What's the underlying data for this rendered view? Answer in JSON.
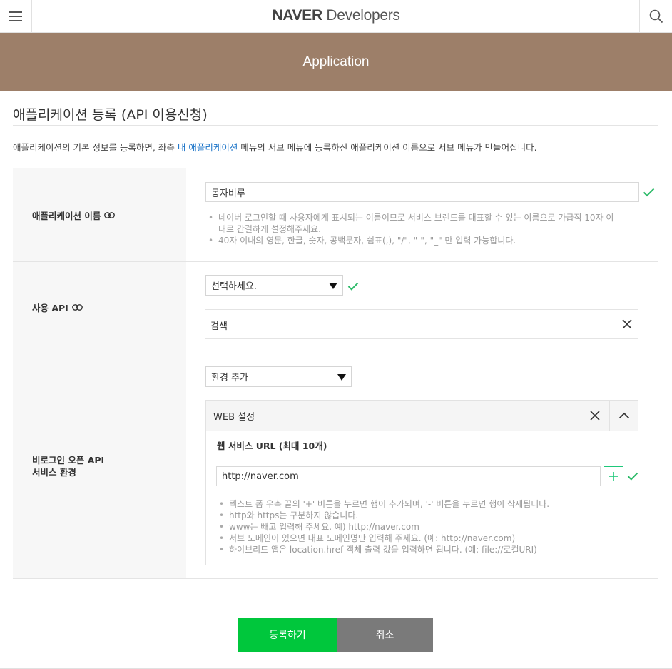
{
  "header": {
    "brand": "NAVER",
    "product": "Developers"
  },
  "banner": {
    "title": "Application"
  },
  "page": {
    "title": "애플리케이션 등록 (API 이용신청)",
    "description_before": "애플리케이션의 기본 정보를 등록하면, 좌측 ",
    "description_link": "내 애플리케이션",
    "description_after": " 메뉴의 서브 메뉴에 등록하신 애플리케이션 이름으로 서브 메뉴가 만들어집니다."
  },
  "form": {
    "app_name": {
      "label": "애플리케이션 이름",
      "value": "몽자비루",
      "hints": [
        "네이버 로그인할 때 사용자에게 표시되는 이름이므로 서비스 브랜드를 대표할 수 있는 이름으로 가급적 10자 이",
        "내로 간결하게 설정해주세요.",
        "40자 이내의 영문, 한글, 숫자, 공백문자, 쉼표(,), \"/\", \"-\", \"_\" 만 입력 가능합니다."
      ]
    },
    "api": {
      "label": "사용 API",
      "select_value": "선택하세요.",
      "selected_item": "검색"
    },
    "env": {
      "label_line1": "비로그인 오픈 API",
      "label_line2": "서비스 환경",
      "select_value": "환경 추가",
      "panel_title": "WEB 설정",
      "url_heading": "웹 서비스 URL (최대 10개)",
      "url_value": "http://naver.com",
      "hints": [
        "텍스트 폼 우측 끝의 '+' 버튼을 누르면 행이 추가되며, '-' 버튼을 누르면 행이 삭제됩니다.",
        "http와 https는 구분하지 않습니다.",
        "www는 빼고 입력해 주세요. 예) http://naver.com",
        "서브 도메인이 있으면 대표 도메인명만 입력해 주세요. (예: http://naver.com)",
        "하이브리드 앱은 location.href 객체 출력 값을 입력하면 됩니다. (예: file://로컬URI)"
      ]
    }
  },
  "actions": {
    "register": "등록하기",
    "cancel": "취소"
  },
  "colors": {
    "banner": "#9d7f69",
    "link": "#1a73c8",
    "primary": "#00c73c",
    "secondary": "#7a7a7a",
    "check": "#1ec87a"
  }
}
